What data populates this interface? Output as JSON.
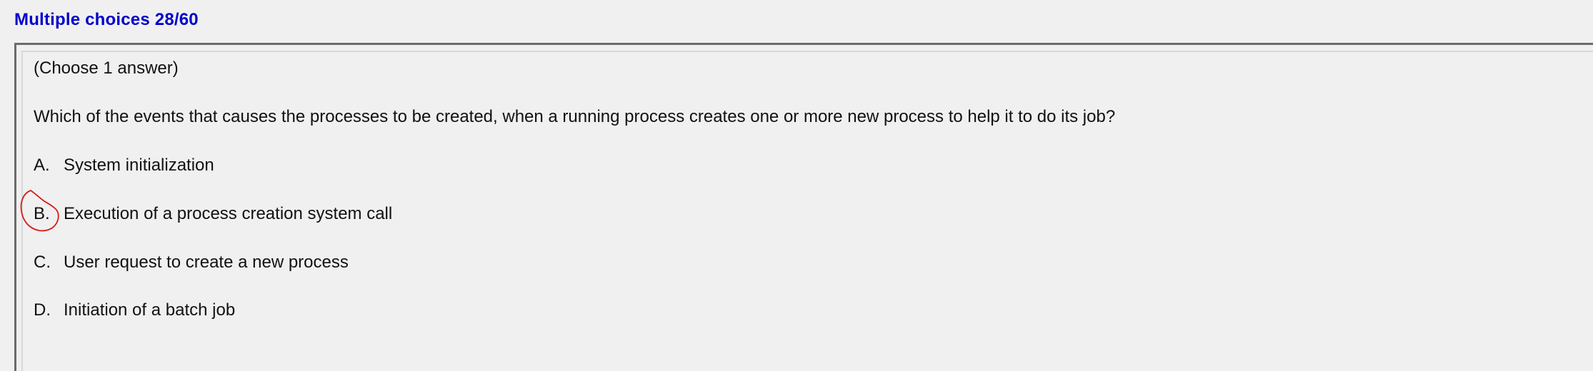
{
  "header": {
    "title": "Multiple choices 28/60"
  },
  "question": {
    "instruction": "(Choose 1 answer)",
    "text": "Which of the events that causes the processes to be created, when a running process creates one or more new process to help it to do its job?",
    "options": [
      {
        "letter": "A.",
        "text": "System initialization"
      },
      {
        "letter": "B.",
        "text": "Execution of a process creation system call"
      },
      {
        "letter": "C.",
        "text": "User request to create a new process"
      },
      {
        "letter": "D.",
        "text": "Initiation of a batch job"
      }
    ],
    "marked_option": "B."
  },
  "colors": {
    "header": "#0000cc",
    "mark": "#d81b1b",
    "background": "#f0f0f0"
  }
}
